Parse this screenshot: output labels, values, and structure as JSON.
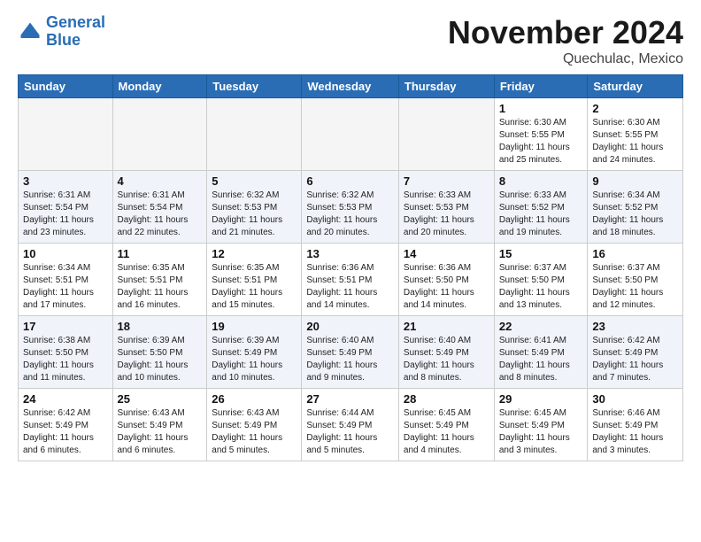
{
  "header": {
    "logo_line1": "General",
    "logo_line2": "Blue",
    "month": "November 2024",
    "location": "Quechulac, Mexico"
  },
  "weekdays": [
    "Sunday",
    "Monday",
    "Tuesday",
    "Wednesday",
    "Thursday",
    "Friday",
    "Saturday"
  ],
  "weeks": [
    [
      {
        "day": "",
        "info": ""
      },
      {
        "day": "",
        "info": ""
      },
      {
        "day": "",
        "info": ""
      },
      {
        "day": "",
        "info": ""
      },
      {
        "day": "",
        "info": ""
      },
      {
        "day": "1",
        "info": "Sunrise: 6:30 AM\nSunset: 5:55 PM\nDaylight: 11 hours\nand 25 minutes."
      },
      {
        "day": "2",
        "info": "Sunrise: 6:30 AM\nSunset: 5:55 PM\nDaylight: 11 hours\nand 24 minutes."
      }
    ],
    [
      {
        "day": "3",
        "info": "Sunrise: 6:31 AM\nSunset: 5:54 PM\nDaylight: 11 hours\nand 23 minutes."
      },
      {
        "day": "4",
        "info": "Sunrise: 6:31 AM\nSunset: 5:54 PM\nDaylight: 11 hours\nand 22 minutes."
      },
      {
        "day": "5",
        "info": "Sunrise: 6:32 AM\nSunset: 5:53 PM\nDaylight: 11 hours\nand 21 minutes."
      },
      {
        "day": "6",
        "info": "Sunrise: 6:32 AM\nSunset: 5:53 PM\nDaylight: 11 hours\nand 20 minutes."
      },
      {
        "day": "7",
        "info": "Sunrise: 6:33 AM\nSunset: 5:53 PM\nDaylight: 11 hours\nand 20 minutes."
      },
      {
        "day": "8",
        "info": "Sunrise: 6:33 AM\nSunset: 5:52 PM\nDaylight: 11 hours\nand 19 minutes."
      },
      {
        "day": "9",
        "info": "Sunrise: 6:34 AM\nSunset: 5:52 PM\nDaylight: 11 hours\nand 18 minutes."
      }
    ],
    [
      {
        "day": "10",
        "info": "Sunrise: 6:34 AM\nSunset: 5:51 PM\nDaylight: 11 hours\nand 17 minutes."
      },
      {
        "day": "11",
        "info": "Sunrise: 6:35 AM\nSunset: 5:51 PM\nDaylight: 11 hours\nand 16 minutes."
      },
      {
        "day": "12",
        "info": "Sunrise: 6:35 AM\nSunset: 5:51 PM\nDaylight: 11 hours\nand 15 minutes."
      },
      {
        "day": "13",
        "info": "Sunrise: 6:36 AM\nSunset: 5:51 PM\nDaylight: 11 hours\nand 14 minutes."
      },
      {
        "day": "14",
        "info": "Sunrise: 6:36 AM\nSunset: 5:50 PM\nDaylight: 11 hours\nand 14 minutes."
      },
      {
        "day": "15",
        "info": "Sunrise: 6:37 AM\nSunset: 5:50 PM\nDaylight: 11 hours\nand 13 minutes."
      },
      {
        "day": "16",
        "info": "Sunrise: 6:37 AM\nSunset: 5:50 PM\nDaylight: 11 hours\nand 12 minutes."
      }
    ],
    [
      {
        "day": "17",
        "info": "Sunrise: 6:38 AM\nSunset: 5:50 PM\nDaylight: 11 hours\nand 11 minutes."
      },
      {
        "day": "18",
        "info": "Sunrise: 6:39 AM\nSunset: 5:50 PM\nDaylight: 11 hours\nand 10 minutes."
      },
      {
        "day": "19",
        "info": "Sunrise: 6:39 AM\nSunset: 5:49 PM\nDaylight: 11 hours\nand 10 minutes."
      },
      {
        "day": "20",
        "info": "Sunrise: 6:40 AM\nSunset: 5:49 PM\nDaylight: 11 hours\nand 9 minutes."
      },
      {
        "day": "21",
        "info": "Sunrise: 6:40 AM\nSunset: 5:49 PM\nDaylight: 11 hours\nand 8 minutes."
      },
      {
        "day": "22",
        "info": "Sunrise: 6:41 AM\nSunset: 5:49 PM\nDaylight: 11 hours\nand 8 minutes."
      },
      {
        "day": "23",
        "info": "Sunrise: 6:42 AM\nSunset: 5:49 PM\nDaylight: 11 hours\nand 7 minutes."
      }
    ],
    [
      {
        "day": "24",
        "info": "Sunrise: 6:42 AM\nSunset: 5:49 PM\nDaylight: 11 hours\nand 6 minutes."
      },
      {
        "day": "25",
        "info": "Sunrise: 6:43 AM\nSunset: 5:49 PM\nDaylight: 11 hours\nand 6 minutes."
      },
      {
        "day": "26",
        "info": "Sunrise: 6:43 AM\nSunset: 5:49 PM\nDaylight: 11 hours\nand 5 minutes."
      },
      {
        "day": "27",
        "info": "Sunrise: 6:44 AM\nSunset: 5:49 PM\nDaylight: 11 hours\nand 5 minutes."
      },
      {
        "day": "28",
        "info": "Sunrise: 6:45 AM\nSunset: 5:49 PM\nDaylight: 11 hours\nand 4 minutes."
      },
      {
        "day": "29",
        "info": "Sunrise: 6:45 AM\nSunset: 5:49 PM\nDaylight: 11 hours\nand 3 minutes."
      },
      {
        "day": "30",
        "info": "Sunrise: 6:46 AM\nSunset: 5:49 PM\nDaylight: 11 hours\nand 3 minutes."
      }
    ]
  ]
}
